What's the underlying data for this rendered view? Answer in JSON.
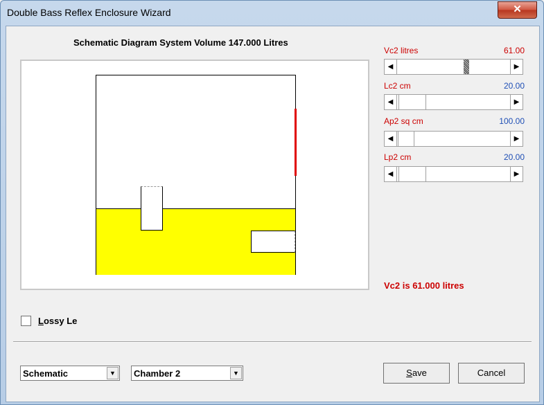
{
  "window": {
    "title": "Double Bass Reflex Enclosure Wizard",
    "close_glyph": "✕"
  },
  "diagram": {
    "title": "Schematic Diagram   System Volume 147.000 Litres"
  },
  "params": [
    {
      "label": "Vc2  litres",
      "value": "61.00"
    },
    {
      "label": "Lc2  cm",
      "value": "20.00"
    },
    {
      "label": "Ap2  sq cm",
      "value": "100.00"
    },
    {
      "label": "Lp2  cm",
      "value": "20.00"
    }
  ],
  "status": "Vc2 is 61.000 litres",
  "lossy": {
    "label_first": "L",
    "label_rest": "ossy Le",
    "checked": false
  },
  "view_select": {
    "value": "Schematic"
  },
  "chamber_select": {
    "value": "Chamber 2"
  },
  "buttons": {
    "save_first": "S",
    "save_rest": "ave",
    "cancel": "Cancel"
  },
  "arrows": {
    "left": "◀",
    "right": "▶",
    "down": "▼"
  },
  "colors": {
    "accent_red": "#cc0000",
    "value_blue": "#1f4fb5",
    "chamber_fill": "#ffff00",
    "driver": "#e00000"
  }
}
